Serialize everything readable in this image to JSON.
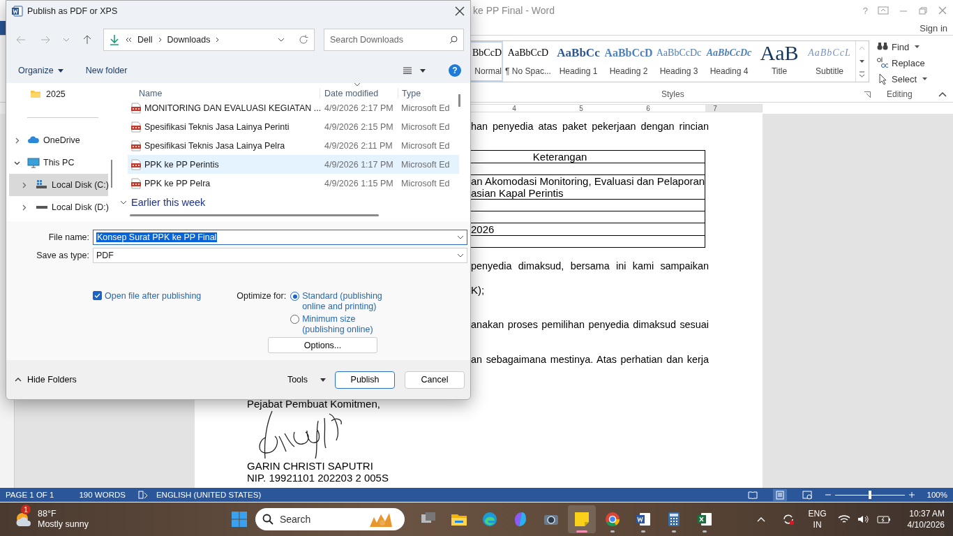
{
  "word": {
    "title": "ke PP Final - Word",
    "help": "?",
    "sign_in": "Sign in",
    "styles": [
      {
        "kind": "body",
        "preview": "BbCcD",
        "name": "Normal",
        "selected": true
      },
      {
        "kind": "body",
        "preview": "AaBbCcD",
        "name": "¶ No Spac...",
        "selected": false
      },
      {
        "kind": "heading1",
        "preview": "AaBbCc",
        "name": "Heading 1",
        "selected": false
      },
      {
        "kind": "heading2",
        "preview": "AaBbCcD",
        "name": "Heading 2",
        "selected": false
      },
      {
        "kind": "heading3",
        "preview": "AaBbCcDc",
        "name": "Heading 3",
        "selected": false
      },
      {
        "kind": "heading4",
        "preview": "AaBbCcDc",
        "name": "Heading 4",
        "selected": false
      },
      {
        "kind": "title",
        "preview": "AaB",
        "name": "Title",
        "selected": false
      },
      {
        "kind": "subtitle",
        "preview": "AaBbCcL",
        "name": "Subtitle",
        "selected": false
      }
    ],
    "styles_label": "Styles",
    "editing": [
      {
        "kind": "find",
        "label": "Find",
        "dropdown": true
      },
      {
        "kind": "replace",
        "label": "Replace",
        "dropdown": false
      },
      {
        "kind": "select",
        "label": "Select",
        "dropdown": true
      }
    ],
    "editing_label": "Editing",
    "ruler_numbers": [
      "4",
      "5",
      "6",
      "7"
    ],
    "document": [
      {
        "kind": "line",
        "text": "han penyedia atas paket pekerjaan dengan rincian"
      },
      {
        "kind": "table",
        "rows": [
          [
            "Keterangan"
          ],
          [],
          [
            "an Akomodasi Monitoring, Evaluasi dan Pelaporan",
            "asian Kapal Perintis"
          ],
          [],
          [],
          [
            "2026"
          ],
          []
        ]
      },
      {
        "kind": "line",
        "text": "penyedia dimaksud, bersama ini kami sampaikan"
      },
      {
        "kind": "short",
        "text": "K);"
      },
      {
        "kind": "line",
        "text": "anakan proses pemilihan penyedia dimaksud sesuai"
      },
      {
        "kind": "line",
        "text": "an sebagaimana mestinya. Atas perhatian dan kerja"
      },
      {
        "kind": "closing",
        "text": "Pejabat Pembuat Komitmen,"
      },
      {
        "kind": "signature"
      },
      {
        "kind": "closing",
        "text": "GARIN CHRISTI SAPUTRI"
      },
      {
        "kind": "closing",
        "text": "NIP.  19921101 202203 2 005S"
      }
    ],
    "status_bar": {
      "page": "PAGE 1 OF 1",
      "words": "190 WORDS",
      "language": "ENGLISH (UNITED STATES)",
      "views": [
        {
          "kind": "read",
          "selected": false
        },
        {
          "kind": "print",
          "selected": true
        },
        {
          "kind": "web",
          "selected": false
        }
      ],
      "zoom": {
        "level": 0.5,
        "reading": "100%"
      }
    }
  },
  "dialog": {
    "title": "Publish as PDF or XPS",
    "path": [
      "Dell",
      "Downloads"
    ],
    "search_placeholder": "Search Downloads",
    "organize": "Organize",
    "new_folder": "New folder",
    "help": "?",
    "nav_tree": [
      {
        "kind": "folder",
        "label": "2025",
        "selected": false
      },
      {
        "kind": "cloud",
        "label": "OneDrive",
        "expanded": false,
        "selected": false
      },
      {
        "kind": "pc",
        "label": "This PC",
        "expanded": true,
        "selected": false,
        "children": [
          {
            "kind": "disk-c",
            "label": "Local Disk (C:)",
            "expanded": false,
            "selected": true
          },
          {
            "kind": "disk",
            "label": "Local Disk (D:)",
            "expanded": false,
            "selected": false
          }
        ]
      }
    ],
    "columns": [
      "Name",
      "Date modified",
      "Type"
    ],
    "files": [
      {
        "name": "MONITORING DAN EVALUASI KEGIATAN ...",
        "date": "4/9/2026 2:17 PM",
        "type": "Microsoft Ed",
        "hovered": false
      },
      {
        "name": "Spesifikasi Teknis Jasa Lainya Perinti",
        "date": "4/9/2026 2:15 PM",
        "type": "Microsoft Ed",
        "hovered": false
      },
      {
        "name": "Spesifikasi Teknis Jasa Lainya Pelra",
        "date": "4/9/2026 2:11 PM",
        "type": "Microsoft Ed",
        "hovered": false
      },
      {
        "name": "PPK ke PP Perintis",
        "date": "4/9/2026 1:17 PM",
        "type": "Microsoft Ed",
        "hovered": true
      },
      {
        "name": "PPK ke PP Pelra",
        "date": "4/9/2026 1:15 PM",
        "type": "Microsoft Ed",
        "hovered": false
      }
    ],
    "group": "Earlier this week",
    "file_name_label": "File name:",
    "file_name": "Konsep Surat PPK ke PP Final",
    "save_type_label": "Save as type:",
    "save_type": "PDF",
    "open_after": {
      "label": "Open file after publishing",
      "checked": true
    },
    "optimize_label": "Optimize for:",
    "optimize": [
      {
        "label": "Standard (publishing online and printing)",
        "selected": true
      },
      {
        "label": "Minimum size (publishing online)",
        "selected": false
      }
    ],
    "options_button": "Options...",
    "hide_folders": "Hide Folders",
    "tools": "Tools",
    "publish": "Publish",
    "cancel": "Cancel"
  },
  "taskbar": {
    "weather": {
      "badge": "1",
      "temp": "88°F",
      "condition": "Mostly sunny"
    },
    "search": "Search",
    "apps": [
      {
        "kind": "task-view",
        "running": false,
        "active": false
      },
      {
        "kind": "explorer",
        "running": false,
        "active": false
      },
      {
        "kind": "edge",
        "running": false,
        "active": false
      },
      {
        "kind": "copilot",
        "running": false,
        "active": false
      },
      {
        "kind": "camera",
        "running": false,
        "active": false
      },
      {
        "kind": "sticky-notes",
        "running": true,
        "active": true
      },
      {
        "kind": "chrome",
        "running": true,
        "active": false
      },
      {
        "kind": "word",
        "running": true,
        "active": false
      },
      {
        "kind": "calculator",
        "running": true,
        "active": false
      },
      {
        "kind": "excel",
        "running": true,
        "active": false
      }
    ],
    "language": [
      "ENG",
      "IN"
    ],
    "time": "10:37 AM",
    "date": "4/10/2026"
  }
}
